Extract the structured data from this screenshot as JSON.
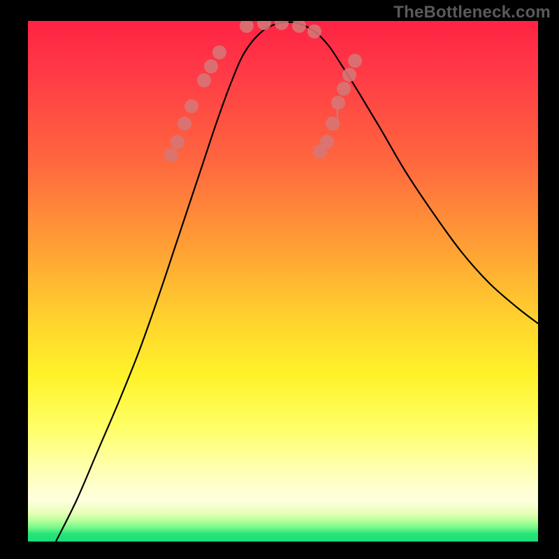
{
  "watermark": "TheBottleneck.com",
  "chart_data": {
    "type": "line",
    "title": "",
    "xlabel": "",
    "ylabel": "",
    "xlim": [
      0,
      730
    ],
    "ylim": [
      0,
      745
    ],
    "background_gradient": {
      "top": "#ff2344",
      "mid_upper": "#ffa534",
      "mid": "#fff22a",
      "mid_lower": "#ffffb0",
      "bottom": "#19df77"
    },
    "series": [
      {
        "name": "bottleneck-curve",
        "color": "#000000",
        "x": [
          40,
          70,
          100,
          130,
          160,
          190,
          210,
          230,
          250,
          270,
          290,
          310,
          335,
          360,
          385,
          410,
          430,
          450,
          475,
          505,
          540,
          580,
          620,
          660,
          700,
          730
        ],
        "y": [
          0,
          60,
          130,
          200,
          275,
          360,
          420,
          480,
          540,
          600,
          655,
          700,
          730,
          742,
          742,
          730,
          710,
          680,
          640,
          590,
          530,
          470,
          415,
          370,
          335,
          312
        ]
      }
    ],
    "highlight_dots": {
      "name": "highlight-dots",
      "color": "#d67676",
      "radius": 10,
      "points": [
        [
          205,
          553
        ],
        [
          214,
          572
        ],
        [
          224,
          598
        ],
        [
          234,
          623
        ],
        [
          252,
          660
        ],
        [
          262,
          680
        ],
        [
          274,
          700
        ],
        [
          313,
          738
        ],
        [
          338,
          742
        ],
        [
          363,
          742
        ],
        [
          388,
          738
        ],
        [
          410,
          730
        ],
        [
          418,
          558
        ],
        [
          428,
          572
        ],
        [
          436,
          598
        ],
        [
          444,
          628
        ],
        [
          452,
          648
        ],
        [
          460,
          668
        ],
        [
          468,
          688
        ]
      ]
    },
    "small_tick": {
      "x": 443,
      "y1": 602,
      "y2": 622,
      "color": "#d67676"
    }
  }
}
